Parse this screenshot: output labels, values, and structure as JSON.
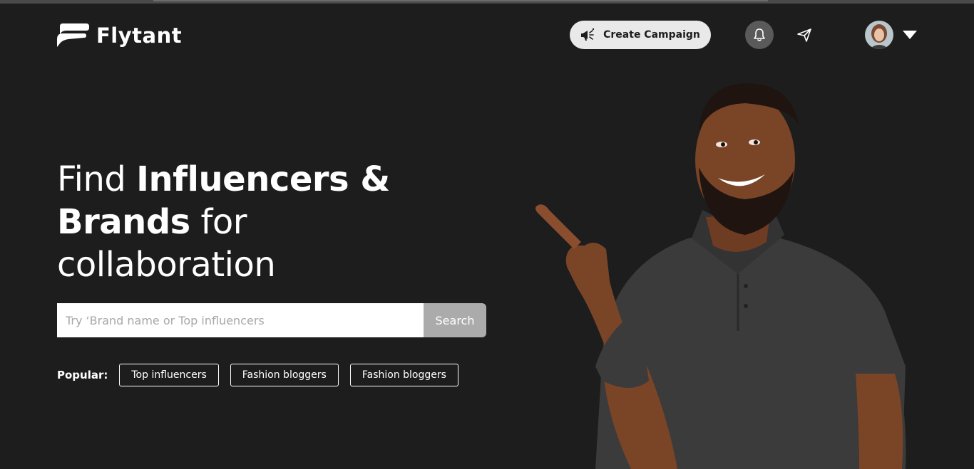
{
  "app": {
    "name": "Flytant"
  },
  "header": {
    "create_campaign_label": "Create Campaign",
    "icons": [
      "megaphone-icon",
      "bell-icon",
      "send-icon",
      "chevron-down-icon"
    ]
  },
  "hero": {
    "line1_regular": "Find ",
    "line1_bold": "Influencers &",
    "line2_bold": "Brands",
    "line2_regular": " for",
    "line3_regular": "collaboration"
  },
  "search": {
    "placeholder": "Try ‘Brand name or Top influencers",
    "value": "",
    "button_label": "Search"
  },
  "popular": {
    "label": "Popular:",
    "items": [
      "Top influencers",
      "Fashion bloggers",
      "Fashion bloggers"
    ]
  },
  "colors": {
    "background": "#1d1d1d",
    "button_light": "#e9e9e9",
    "search_button": "#ababab",
    "bell_bg": "#5a5a5a"
  }
}
